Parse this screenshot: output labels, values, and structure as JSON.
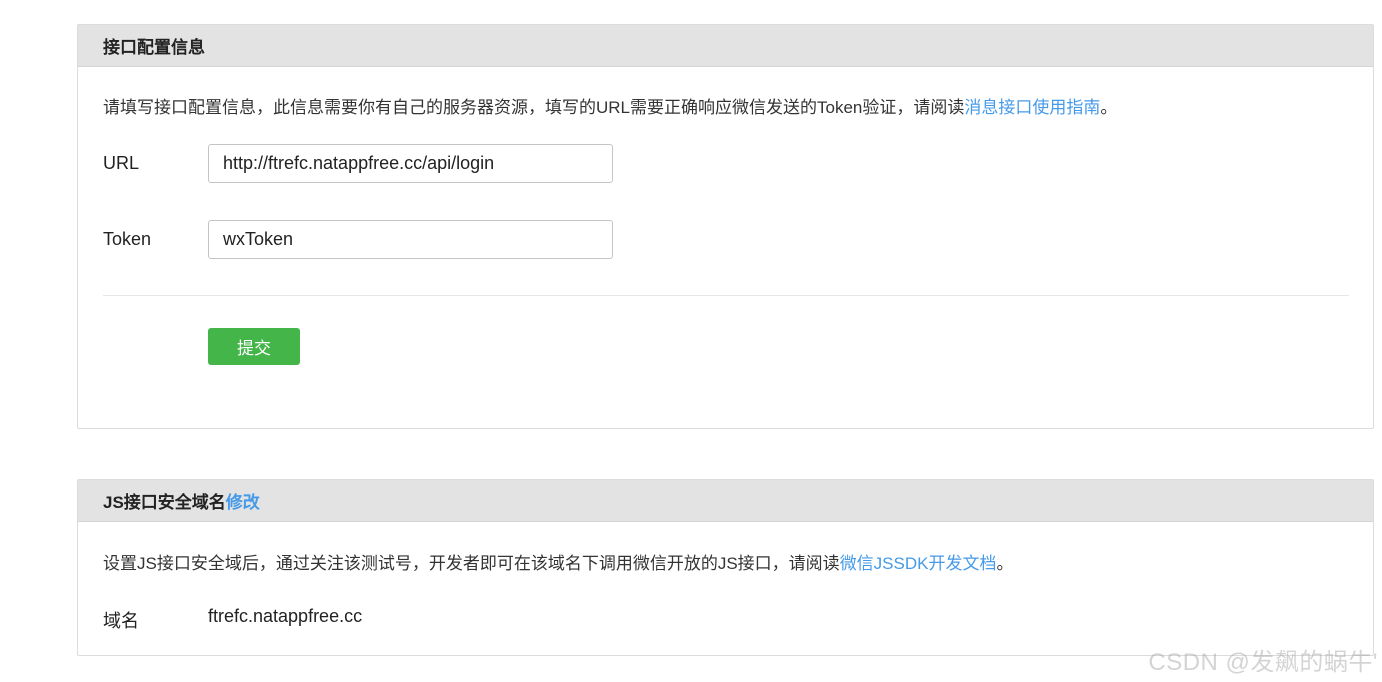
{
  "interface_config": {
    "title": "接口配置信息",
    "description": "请填写接口配置信息，此信息需要你有自己的服务器资源，填写的URL需要正确响应微信发送的Token验证，请阅读",
    "doc_link": "消息接口使用指南",
    "description_end": "。",
    "url_label": "URL",
    "url_value": "http://ftrefc.natappfree.cc/api/login",
    "token_label": "Token",
    "token_value": "wxToken",
    "submit_label": "提交"
  },
  "js_domain": {
    "title": "JS接口安全域名",
    "edit_link": "修改",
    "description": "设置JS接口安全域后，通过关注该测试号，开发者即可在该域名下调用微信开放的JS接口，请阅读",
    "doc_link": "微信JSSDK开发文档",
    "description_end": "。",
    "domain_label": "域名",
    "domain_value": "ftrefc.natappfree.cc"
  },
  "watermark": "CSDN @发飙的蜗牛'",
  "colors": {
    "link": "#459ae9",
    "primary_button": "#44b549",
    "header_bg": "#e3e3e3"
  }
}
